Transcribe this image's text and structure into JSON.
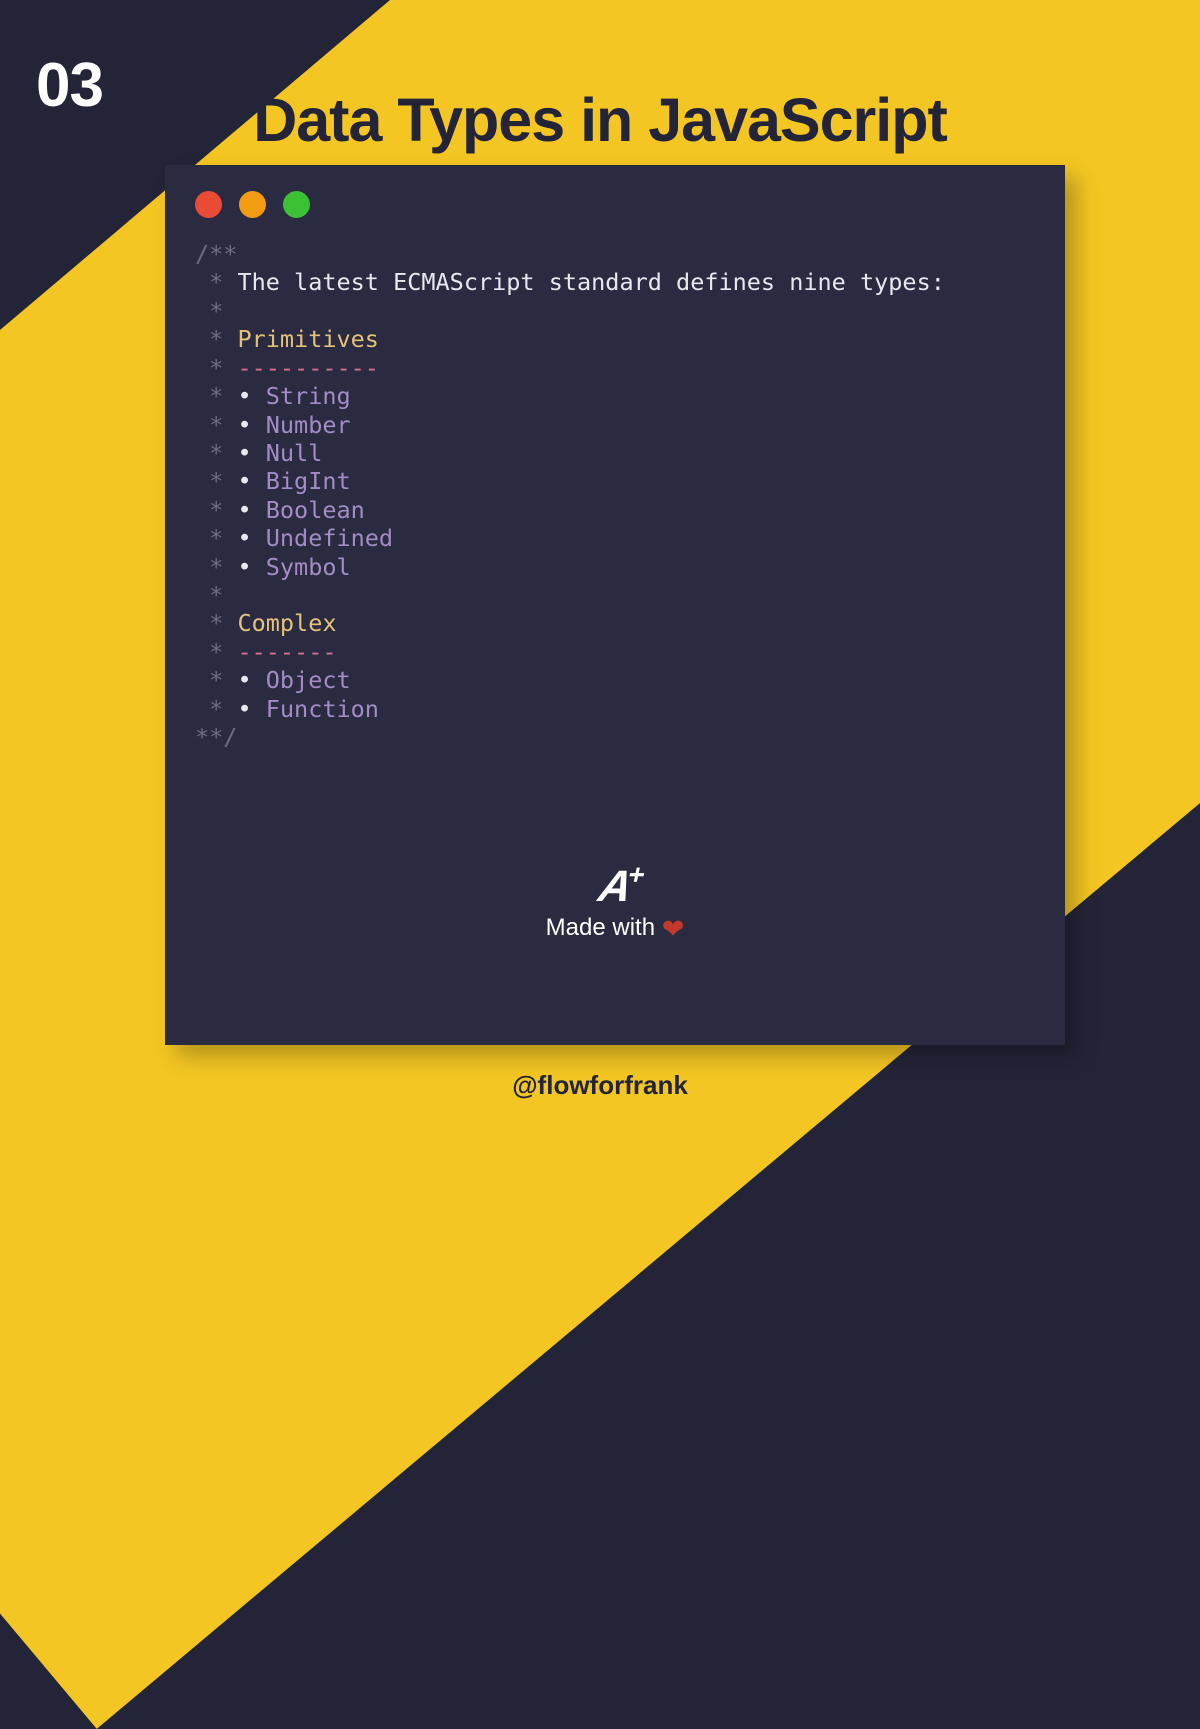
{
  "page_number": "03",
  "title": "Data Types in JavaScript",
  "code": {
    "open": "/**",
    "intro": "The latest ECMAScript standard defines nine types:",
    "section1_heading": "Primitives",
    "section1_divider": "----------",
    "primitives": [
      "String",
      "Number",
      "Null",
      "BigInt",
      "Boolean",
      "Undefined",
      "Symbol"
    ],
    "section2_heading": "Complex",
    "section2_divider": "-------",
    "complex": [
      "Object",
      "Function"
    ],
    "close": "**/"
  },
  "footer": {
    "logo_text": "A",
    "logo_plus": "+",
    "made_with": "Made with",
    "heart": "❤"
  },
  "handle": "@flowforfrank"
}
